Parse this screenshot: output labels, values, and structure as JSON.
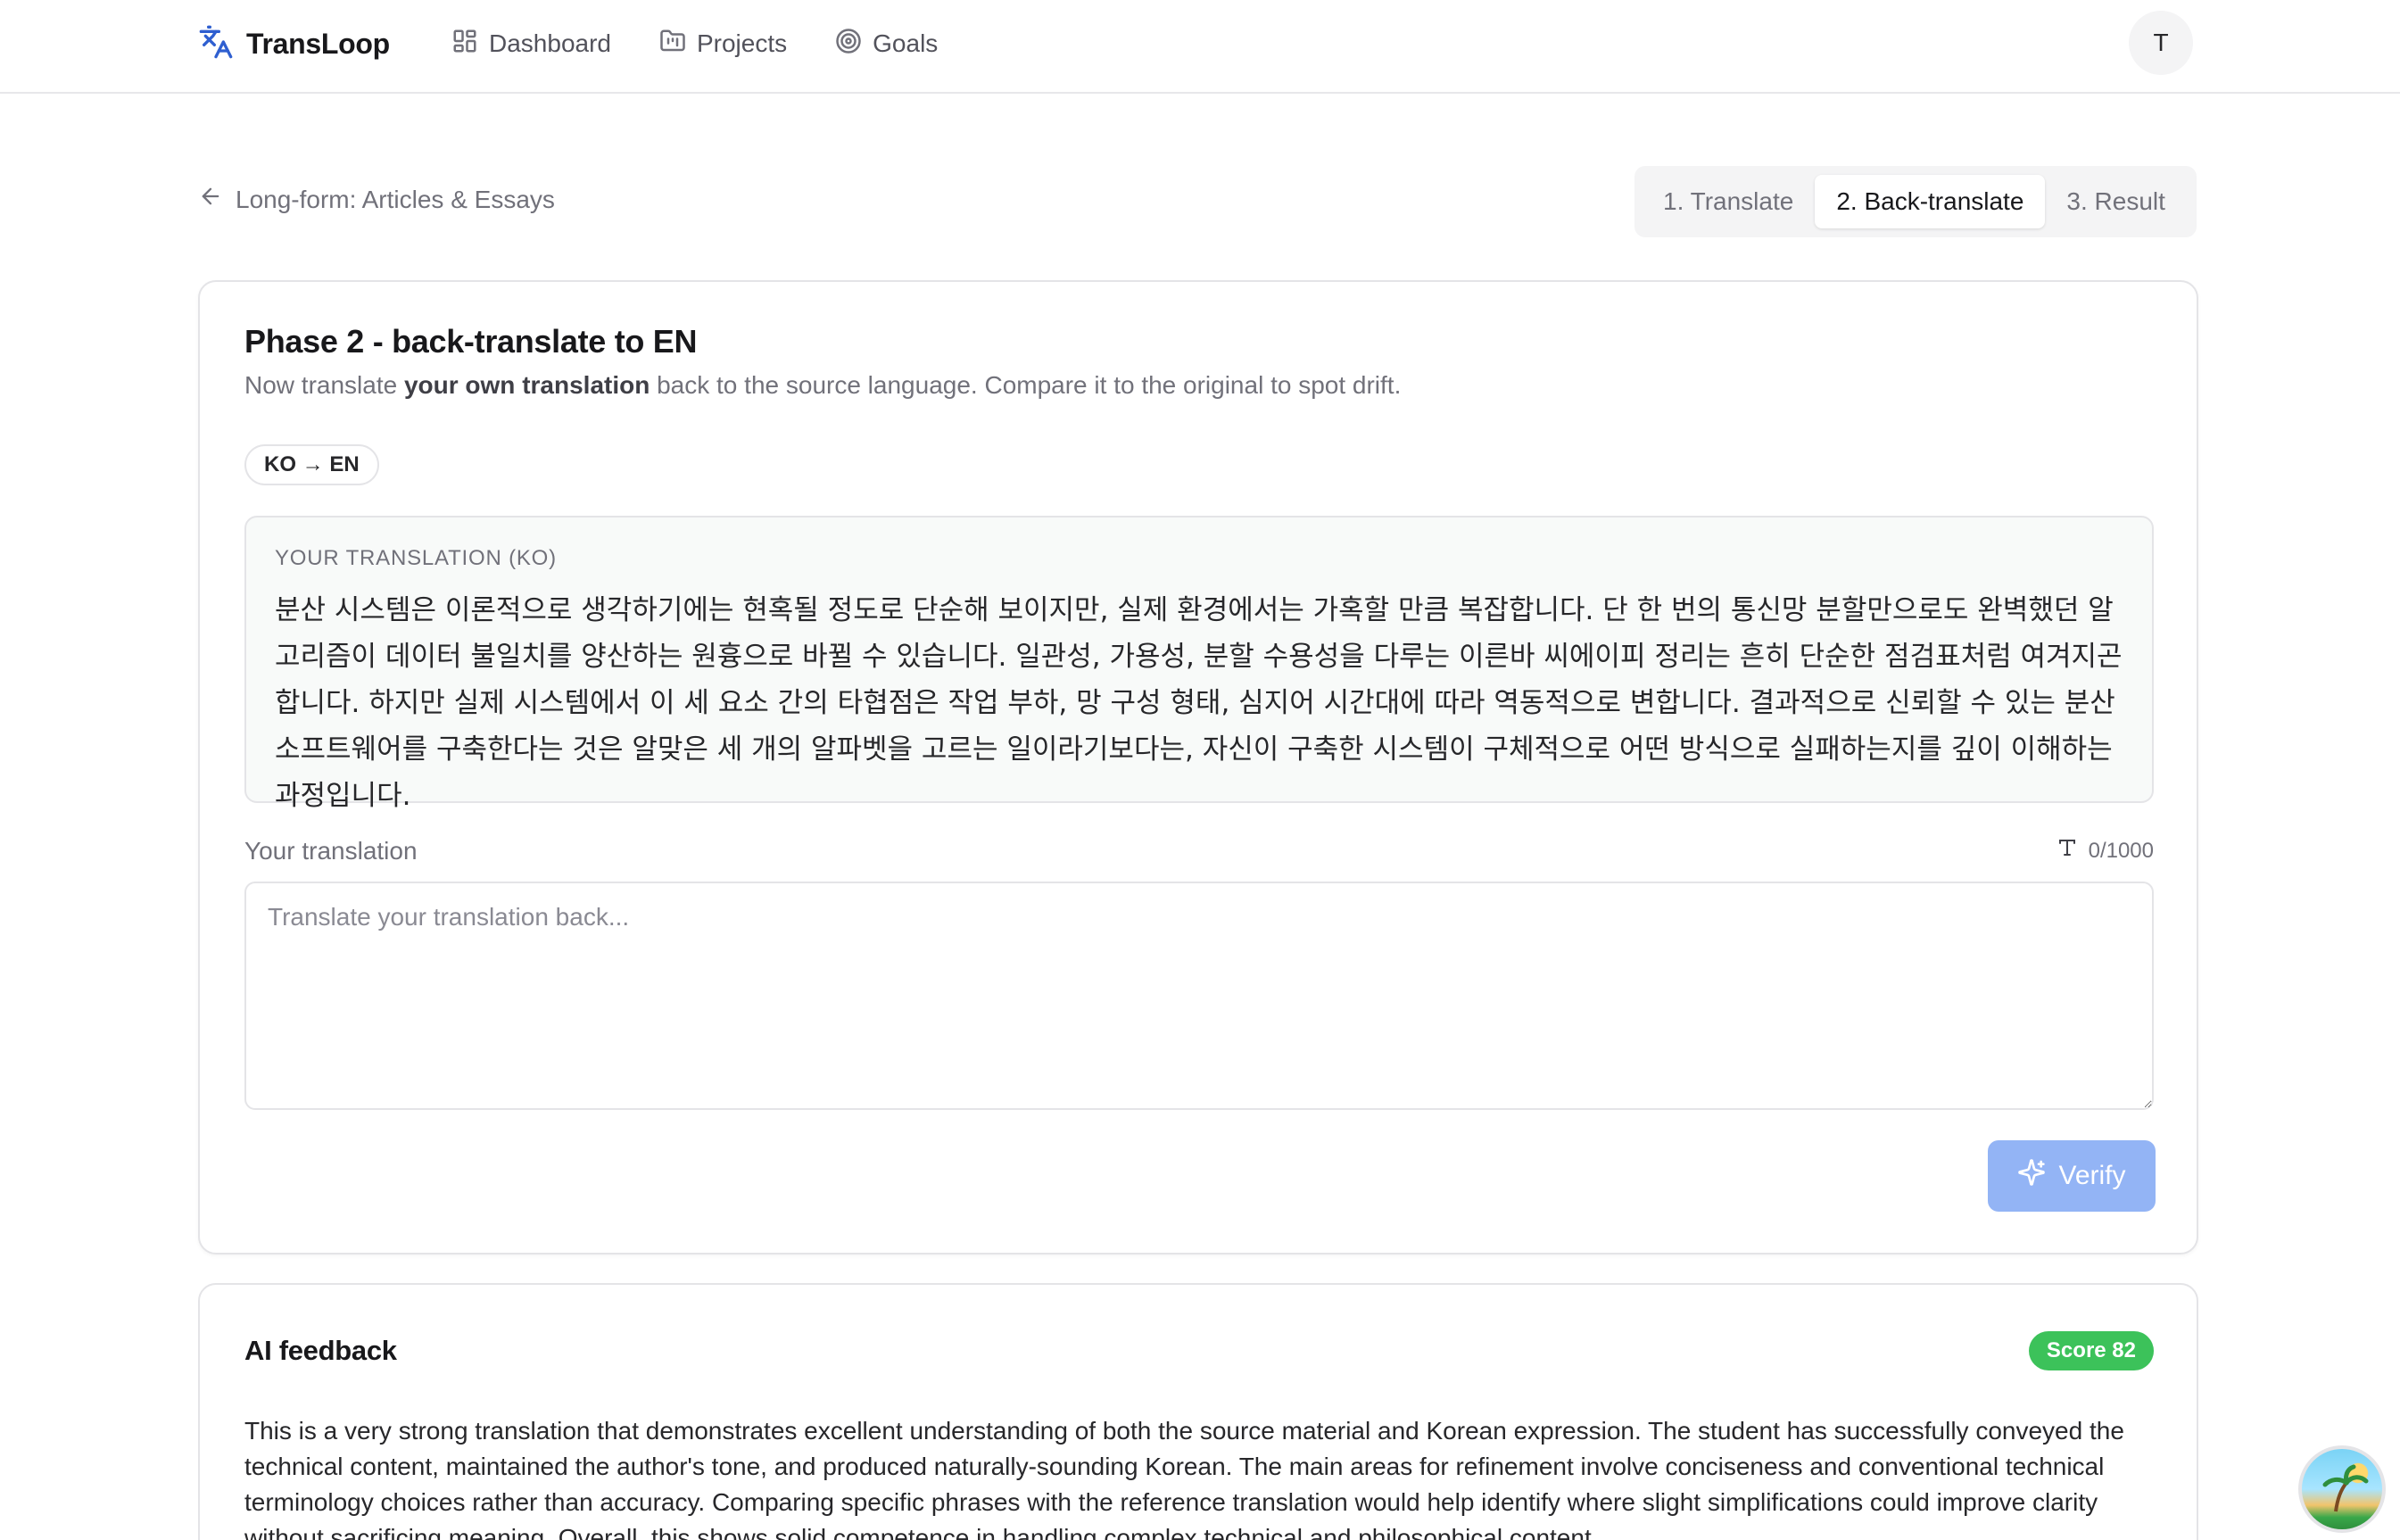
{
  "app": {
    "name": "TransLoop"
  },
  "nav": {
    "items": [
      {
        "label": "Dashboard",
        "icon": "dashboard-icon"
      },
      {
        "label": "Projects",
        "icon": "folder-icon"
      },
      {
        "label": "Goals",
        "icon": "target-icon"
      }
    ]
  },
  "user": {
    "initial": "T"
  },
  "breadcrumb": {
    "back_label": "Long-form: Articles & Essays"
  },
  "steps": [
    {
      "label": "1. Translate",
      "active": false
    },
    {
      "label": "2. Back-translate",
      "active": true
    },
    {
      "label": "3. Result",
      "active": false
    }
  ],
  "phase": {
    "title": "Phase 2 - back-translate to EN",
    "subtitle_pre": "Now translate ",
    "subtitle_bold": "your own translation",
    "subtitle_post": " back to the source language. Compare it to the original to spot drift.",
    "lang_pair": "KO → EN"
  },
  "source": {
    "label": "YOUR TRANSLATION (KO)",
    "text": "분산 시스템은 이론적으로 생각하기에는 현혹될 정도로 단순해 보이지만, 실제 환경에서는 가혹할 만큼 복잡합니다. 단 한 번의 통신망 분할만으로도 완벽했던 알고리즘이 데이터 불일치를 양산하는 원흉으로 바뀔 수 있습니다. 일관성, 가용성, 분할 수용성을 다루는 이른바 씨에이피 정리는 흔히 단순한 점검표처럼 여겨지곤 합니다. 하지만 실제 시스템에서 이 세 요소 간의 타협점은 작업 부하, 망 구성 형태, 심지어 시간대에 따라 역동적으로 변합니다. 결과적으로 신뢰할 수 있는 분산 소프트웨어를 구축한다는 것은 알맞은 세 개의 알파벳을 고르는 일이라기보다는, 자신이 구축한 시스템이 구체적으로 어떤 방식으로 실패하는지를 깊이 이해하는 과정입니다."
  },
  "input": {
    "label": "Your translation",
    "counter": "0/1000",
    "placeholder": "Translate your translation back...",
    "value": ""
  },
  "verify": {
    "label": "Verify"
  },
  "feedback": {
    "title": "AI feedback",
    "score": "Score 82",
    "text": "This is a very strong translation that demonstrates excellent understanding of both the source material and Korean expression. The student has successfully conveyed the technical content, maintained the author's tone, and produced naturally-sounding Korean. The main areas for refinement involve conciseness and conventional technical terminology choices rather than accuracy. Comparing specific phrases with the reference translation would help identify where slight simplifications could improve clarity without sacrificing meaning. Overall, this shows solid competence in handling complex technical and philosophical content."
  },
  "colors": {
    "accent": "#2f5fd0",
    "verify_disabled": "#93b4f5",
    "score_green": "#3cc25a",
    "border": "#e4e4e7"
  }
}
